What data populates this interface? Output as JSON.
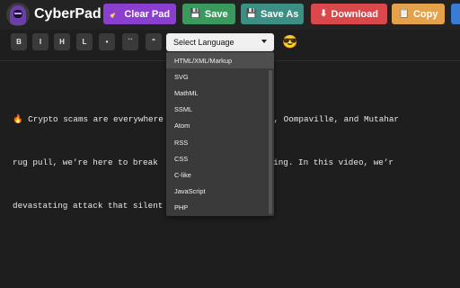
{
  "header": {
    "app_title": "CyberPad",
    "buttons": {
      "clear": "Clear Pad",
      "save": "Save",
      "save_as": "Save As",
      "download": "Download",
      "copy": "Copy"
    },
    "icons": {
      "clear": "🧹",
      "save": "💾",
      "save_as": "💾",
      "download": "⬇",
      "copy": "📋"
    }
  },
  "toolbar": {
    "buttons": [
      "B",
      "I",
      "H",
      "L",
      "•",
      "``",
      "\""
    ],
    "language_select": "Select Language",
    "emoji": "😎"
  },
  "editor": {
    "lines": [
      "🔥 Crypto scams are everywhere            offeezilla, Oompaville, and Mutahar",
      "rug pull, we’re here to break            Crypto Hacking. In this video, we’r",
      "devastating attack that silent"
    ]
  },
  "dropdown": {
    "options": [
      "HTML/XML/Markup",
      "SVG",
      "MathML",
      "SSML",
      "Atom",
      "RSS",
      "CSS",
      "C-like",
      "JavaScript",
      "PHP"
    ],
    "selected": "HTML/XML/Markup"
  },
  "colors": {
    "clear": "#8a3fd1",
    "save": "#3a9a5d",
    "save_as": "#3b8f83",
    "download": "#d9494b",
    "copy": "#e4a34a",
    "background": "#1e1e1e"
  }
}
